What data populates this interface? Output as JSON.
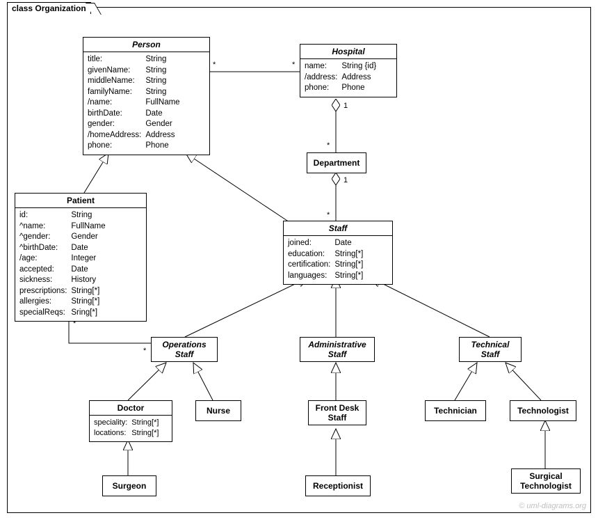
{
  "frame": {
    "label": "class Organization"
  },
  "credit": "© uml-diagrams.org",
  "classes": {
    "person": {
      "name": "Person",
      "attrs": [
        [
          "title:",
          "String"
        ],
        [
          "givenName:",
          "String"
        ],
        [
          "middleName:",
          "String"
        ],
        [
          "familyName:",
          "String"
        ],
        [
          "/name:",
          "FullName"
        ],
        [
          "birthDate:",
          "Date"
        ],
        [
          "gender:",
          "Gender"
        ],
        [
          "/homeAddress:",
          "Address"
        ],
        [
          "phone:",
          "Phone"
        ]
      ]
    },
    "hospital": {
      "name": "Hospital",
      "attrs": [
        [
          "name:",
          "String {id}"
        ],
        [
          "/address:",
          "Address"
        ],
        [
          "phone:",
          "Phone"
        ]
      ]
    },
    "department": {
      "name": "Department"
    },
    "patient": {
      "name": "Patient",
      "attrs": [
        [
          "id:",
          "String"
        ],
        [
          "^name:",
          "FullName"
        ],
        [
          "^gender:",
          "Gender"
        ],
        [
          "^birthDate:",
          "Date"
        ],
        [
          "/age:",
          "Integer"
        ],
        [
          "accepted:",
          "Date"
        ],
        [
          "sickness:",
          "History"
        ],
        [
          "prescriptions:",
          "String[*]"
        ],
        [
          "allergies:",
          "String[*]"
        ],
        [
          "specialReqs:",
          "Sring[*]"
        ]
      ]
    },
    "staff": {
      "name": "Staff",
      "attrs": [
        [
          "joined:",
          "Date"
        ],
        [
          "education:",
          "String[*]"
        ],
        [
          "certification:",
          "String[*]"
        ],
        [
          "languages:",
          "String[*]"
        ]
      ]
    },
    "opsStaff": {
      "name": "Operations\nStaff"
    },
    "adminStaff": {
      "name": "Administrative\nStaff"
    },
    "techStaff": {
      "name": "Technical\nStaff"
    },
    "doctor": {
      "name": "Doctor",
      "attrs": [
        [
          "speciality:",
          "String[*]"
        ],
        [
          "locations:",
          "String[*]"
        ]
      ]
    },
    "nurse": {
      "name": "Nurse"
    },
    "frontDesk": {
      "name": "Front Desk\nStaff"
    },
    "technician": {
      "name": "Technician"
    },
    "technologist": {
      "name": "Technologist"
    },
    "surgeon": {
      "name": "Surgeon"
    },
    "receptionist": {
      "name": "Receptionist"
    },
    "surgicalTech": {
      "name": "Surgical\nTechnologist"
    }
  },
  "mult": {
    "personAssocL": "*",
    "personAssocR": "*",
    "hospDept1": "1",
    "hospDeptStar": "*",
    "deptStaff1": "1",
    "deptStaffStar": "*",
    "patOpsStar1": "*",
    "patOpsStar2": "*"
  }
}
